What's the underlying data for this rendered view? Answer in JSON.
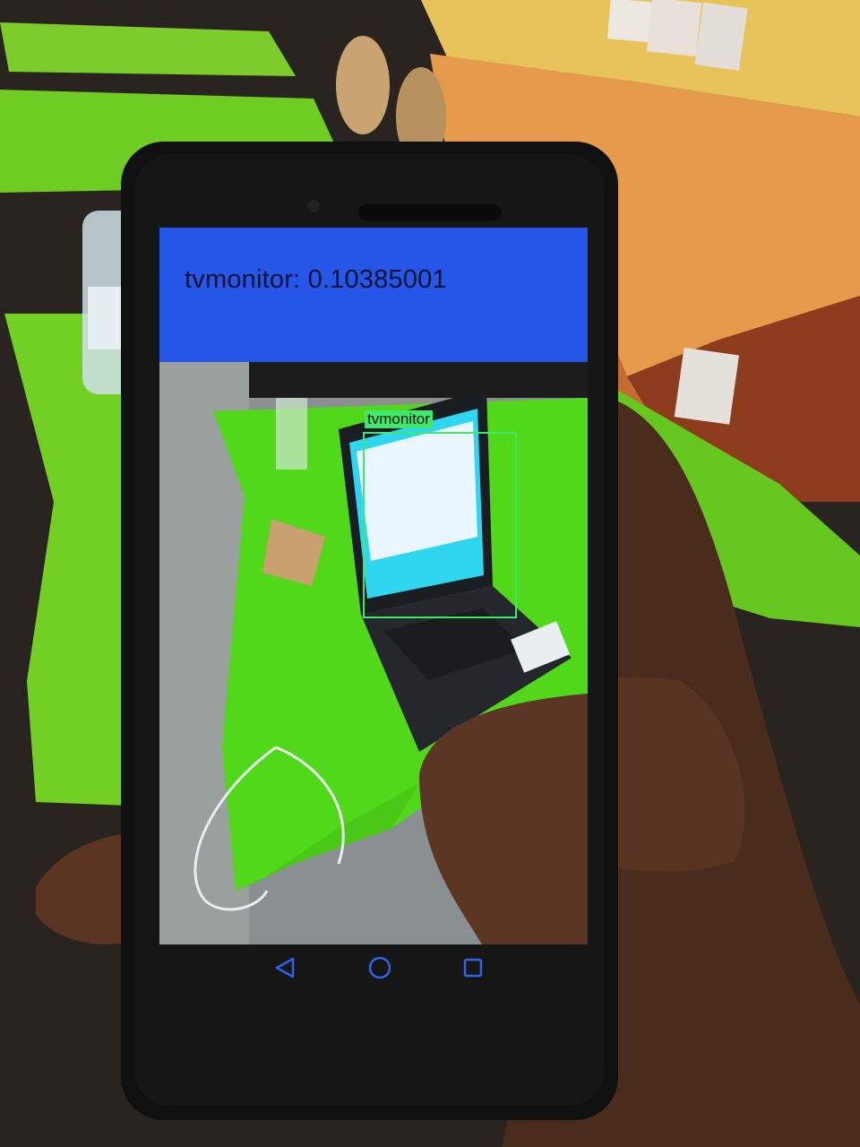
{
  "app": {
    "detection_result": "tvmonitor: 0.10385001",
    "detections": [
      {
        "label": "tvmonitor",
        "score": 0.10385001
      }
    ]
  },
  "navigation": {
    "back_icon": "triangle-back-icon",
    "home_icon": "circle-home-icon",
    "recents_icon": "square-recents-icon"
  },
  "colors": {
    "header_blue": "#2556e8",
    "box_green": "#3ee86a",
    "table_green": "#63d61c"
  }
}
